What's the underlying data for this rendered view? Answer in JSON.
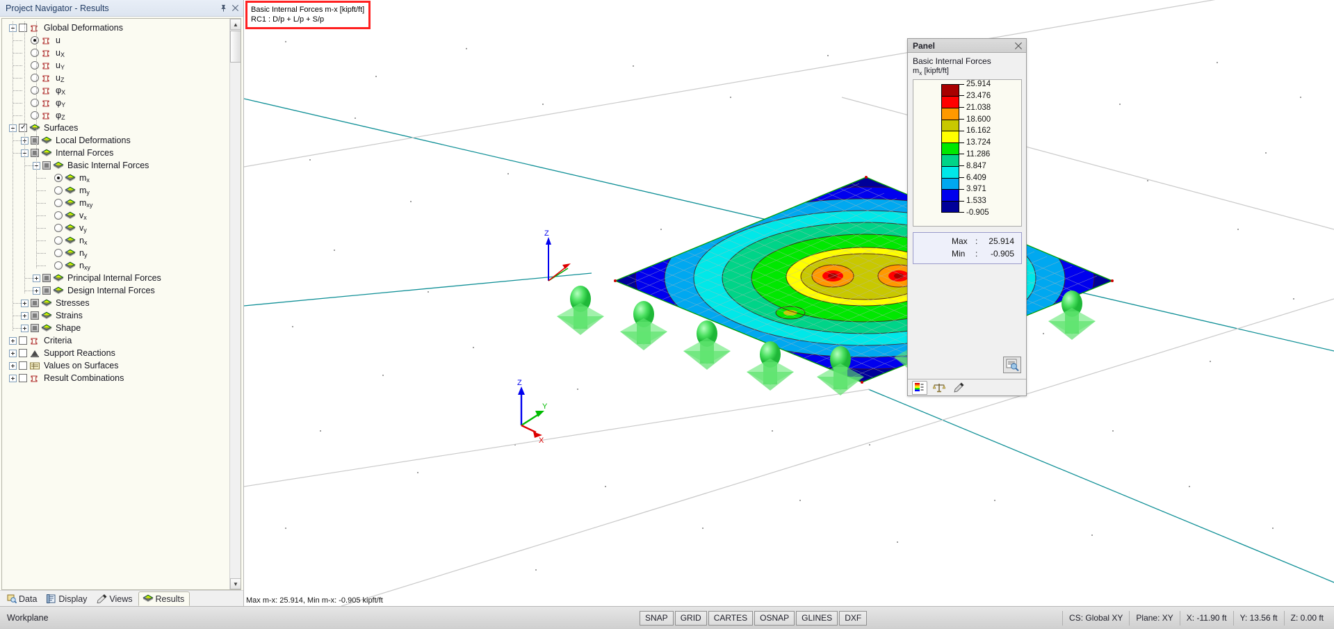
{
  "navigator": {
    "title": "Project Navigator - Results",
    "pin_icon": "pin-icon",
    "close_icon": "close-icon",
    "tree": [
      {
        "label": "Global Deformations",
        "depth": 0,
        "exp": "minus",
        "box": "empty",
        "icon": "surface-plain",
        "sub": ""
      },
      {
        "label": "u",
        "depth": 1,
        "exp": "none",
        "box": "radio-sel",
        "icon": "surface-plain",
        "sub": ""
      },
      {
        "label": "u",
        "depth": 1,
        "exp": "none",
        "box": "radio",
        "icon": "surface-plain",
        "sub": "X"
      },
      {
        "label": "u",
        "depth": 1,
        "exp": "none",
        "box": "radio",
        "icon": "surface-plain",
        "sub": "Y"
      },
      {
        "label": "u",
        "depth": 1,
        "exp": "none",
        "box": "radio",
        "icon": "surface-plain",
        "sub": "Z"
      },
      {
        "label": "φ",
        "depth": 1,
        "exp": "none",
        "box": "radio",
        "icon": "surface-plain",
        "sub": "X"
      },
      {
        "label": "φ",
        "depth": 1,
        "exp": "none",
        "box": "radio",
        "icon": "surface-plain",
        "sub": "Y"
      },
      {
        "label": "φ",
        "depth": 1,
        "exp": "none",
        "box": "radio",
        "icon": "surface-plain",
        "sub": "Z"
      },
      {
        "label": "Surfaces",
        "depth": 0,
        "exp": "minus",
        "box": "checked",
        "icon": "surface-color",
        "sub": ""
      },
      {
        "label": "Local Deformations",
        "depth": 1,
        "exp": "plus",
        "box": "filled",
        "icon": "surface-color",
        "sub": ""
      },
      {
        "label": "Internal Forces",
        "depth": 1,
        "exp": "minus",
        "box": "filled",
        "icon": "surface-color",
        "sub": ""
      },
      {
        "label": "Basic Internal Forces",
        "depth": 2,
        "exp": "minus",
        "box": "filled",
        "icon": "surface-color",
        "sub": ""
      },
      {
        "label": "m",
        "depth": 3,
        "exp": "none",
        "box": "radio-sel",
        "icon": "surface-color",
        "sub": "x"
      },
      {
        "label": "m",
        "depth": 3,
        "exp": "none",
        "box": "radio",
        "icon": "surface-color",
        "sub": "y"
      },
      {
        "label": "m",
        "depth": 3,
        "exp": "none",
        "box": "radio",
        "icon": "surface-color",
        "sub": "xy"
      },
      {
        "label": "v",
        "depth": 3,
        "exp": "none",
        "box": "radio",
        "icon": "surface-color",
        "sub": "x"
      },
      {
        "label": "v",
        "depth": 3,
        "exp": "none",
        "box": "radio",
        "icon": "surface-color",
        "sub": "y"
      },
      {
        "label": "n",
        "depth": 3,
        "exp": "none",
        "box": "radio",
        "icon": "surface-color",
        "sub": "x"
      },
      {
        "label": "n",
        "depth": 3,
        "exp": "none",
        "box": "radio",
        "icon": "surface-color",
        "sub": "y"
      },
      {
        "label": "n",
        "depth": 3,
        "exp": "none",
        "box": "radio",
        "icon": "surface-color",
        "sub": "xy"
      },
      {
        "label": "Principal Internal Forces",
        "depth": 2,
        "exp": "plus",
        "box": "filled",
        "icon": "surface-color",
        "sub": ""
      },
      {
        "label": "Design Internal Forces",
        "depth": 2,
        "exp": "plus",
        "box": "filled",
        "icon": "surface-color",
        "sub": ""
      },
      {
        "label": "Stresses",
        "depth": 1,
        "exp": "plus",
        "box": "filled",
        "icon": "surface-color",
        "sub": ""
      },
      {
        "label": "Strains",
        "depth": 1,
        "exp": "plus",
        "box": "filled",
        "icon": "surface-color",
        "sub": ""
      },
      {
        "label": "Shape",
        "depth": 1,
        "exp": "plus",
        "box": "filled",
        "icon": "surface-color",
        "sub": ""
      },
      {
        "label": "Criteria",
        "depth": 0,
        "exp": "plus",
        "box": "empty",
        "icon": "surface-plain",
        "sub": ""
      },
      {
        "label": "Support Reactions",
        "depth": 0,
        "exp": "plus",
        "box": "empty",
        "icon": "support-icon",
        "sub": ""
      },
      {
        "label": "Values on Surfaces",
        "depth": 0,
        "exp": "plus",
        "box": "empty",
        "icon": "values-icon",
        "sub": ""
      },
      {
        "label": "Result Combinations",
        "depth": 0,
        "exp": "plus",
        "box": "empty",
        "icon": "surface-plain",
        "sub": ""
      }
    ],
    "tabs": [
      {
        "label": "Data",
        "icon": "data-icon",
        "active": false
      },
      {
        "label": "Display",
        "icon": "display-icon",
        "active": false
      },
      {
        "label": "Views",
        "icon": "views-icon",
        "active": false
      },
      {
        "label": "Results",
        "icon": "results-icon",
        "active": true
      }
    ]
  },
  "viewport": {
    "annotation": {
      "line1": "Basic Internal Forces m-x [kipft/ft]",
      "line2": "RC1 : D/p + L/p + S/p",
      "border_color": "#ff2020"
    },
    "status_text": "Max m-x: 25.914, Min m-x: -0.905 kipft/ft",
    "axis_triad": {
      "x": "X",
      "y": "Y",
      "z": "Z",
      "x_color": "#ff0000",
      "y_color": "#00cc00",
      "z_color": "#0000ee"
    },
    "plate_axis_label_z": "Z",
    "support_count": 10,
    "support_color": "#44dd55"
  },
  "panel": {
    "title": "Panel",
    "close_icon": "close-icon",
    "heading": "Basic Internal Forces",
    "quantity": "m",
    "quantity_sub": "x",
    "unit": "[kipft/ft]",
    "max_label": "Max",
    "min_label": "Min",
    "colon": ":",
    "max_value": "25.914",
    "min_value": "-0.905",
    "zoom_icon": "legend-zoom-icon",
    "tabs": [
      {
        "icon": "color-legend-icon",
        "active": true
      },
      {
        "icon": "scales-icon",
        "active": false
      },
      {
        "icon": "factors-icon",
        "active": false
      }
    ]
  },
  "chart_data": {
    "type": "heatmap",
    "title": "Basic Internal Forces m-x [kipft/ft]",
    "subtitle": "RC1 : D/p + L/p + S/p",
    "quantity": "mx",
    "unit": "kipft/ft",
    "legend_position": "right",
    "max": 25.914,
    "min": -0.905,
    "tick_values": [
      25.914,
      23.476,
      21.038,
      18.6,
      16.162,
      13.724,
      11.286,
      8.847,
      6.409,
      3.971,
      1.533,
      -0.905
    ],
    "tick_labels": [
      "25.914",
      "23.476",
      "21.038",
      "18.600",
      "16.162",
      "13.724",
      "11.286",
      "8.847",
      "6.409",
      "3.971",
      "1.533",
      "-0.905"
    ],
    "band_colors": [
      "#a80000",
      "#ff0000",
      "#ff9900",
      "#c8c800",
      "#ffff00",
      "#00e800",
      "#00d488",
      "#00e8e8",
      "#00a8f0",
      "#0000ee",
      "#000099"
    ],
    "band_ranges": [
      [
        23.476,
        25.914
      ],
      [
        21.038,
        23.476
      ],
      [
        18.6,
        21.038
      ],
      [
        16.162,
        18.6
      ],
      [
        13.724,
        16.162
      ],
      [
        11.286,
        13.724
      ],
      [
        8.847,
        11.286
      ],
      [
        6.409,
        8.847
      ],
      [
        3.971,
        6.409
      ],
      [
        1.533,
        3.971
      ],
      [
        -0.905,
        1.533
      ]
    ]
  },
  "statusbar": {
    "workplane": "Workplane",
    "toggles": [
      "SNAP",
      "GRID",
      "CARTES",
      "OSNAP",
      "GLINES",
      "DXF"
    ],
    "cs": "CS: Global XY",
    "plane": "Plane: XY",
    "x": "X:  -11.90 ft",
    "y": "Y:  13.56 ft",
    "z": "Z:  0.00 ft"
  }
}
